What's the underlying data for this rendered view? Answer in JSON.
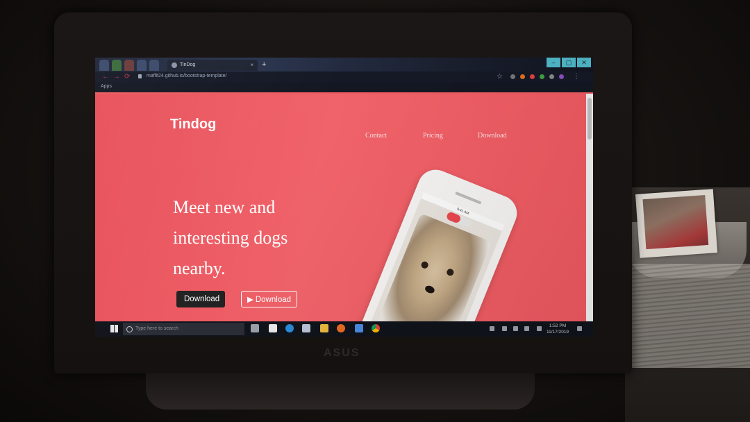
{
  "browser": {
    "tab_title": "TinDog",
    "tab_close": "×",
    "new_tab": "+",
    "url": "maffit24.github.io/bootstrap-template/",
    "bookmarks_label": "Apps",
    "window_controls": [
      "–",
      "▢",
      "✕"
    ]
  },
  "site": {
    "brand": "Tindog",
    "nav": [
      "Contact",
      "Pricing",
      "Download"
    ],
    "headline_lines": [
      "Meet new and",
      "interesting dogs",
      "nearby."
    ],
    "buttons": {
      "apple_download": "Download",
      "google_download": "Download"
    },
    "accent_color": "#ec5a60"
  },
  "phone": {
    "status_text": "9:41 AM"
  },
  "taskbar": {
    "search_placeholder": "Type here to search",
    "time": "1:52 PM",
    "date": "11/17/2019"
  },
  "icons": [
    "windows-start-icon",
    "search-icon",
    "task-view-icon",
    "store-icon",
    "edge-icon",
    "file-explorer-icon",
    "firefox-icon",
    "chrome-icon",
    "apple-icon",
    "play-icon"
  ]
}
